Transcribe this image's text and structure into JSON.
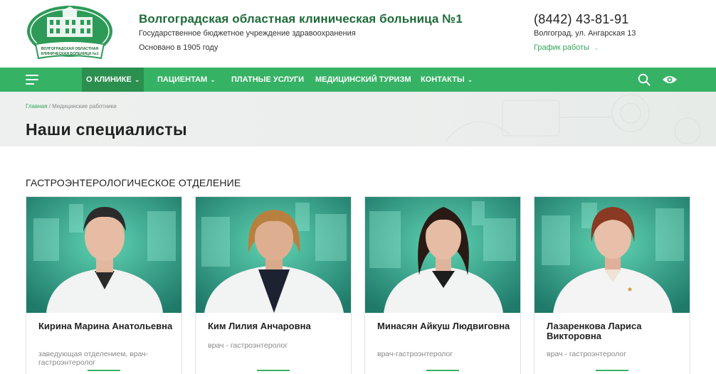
{
  "header": {
    "logo_text_line1": "ВОЛГОГРАДСКАЯ ОБЛАСТНАЯ",
    "logo_text_line2": "КЛИНИЧЕСКАЯ БОЛЬНИЦА №1",
    "title": "Волгоградская областная клиническая больница №1",
    "subtitle": "Государственное бюджетное учреждение здравоохранения",
    "founded": "Основано в 1905 году",
    "phone": "(8442) 43-81-91",
    "address": "Волгоград, ул. Ангарская 13",
    "schedule_label": "График работы",
    "accent_color": "#36b265",
    "title_color": "#1f6b3a"
  },
  "nav": {
    "menu_icon": "hamburger-icon",
    "items": [
      {
        "label": "О КЛИНИКЕ",
        "has_dropdown": true,
        "active": true
      },
      {
        "label": "ПАЦИЕНТАМ",
        "has_dropdown": true,
        "active": false
      },
      {
        "label": "ПЛАТНЫЕ УСЛУГИ",
        "has_dropdown": false,
        "active": false
      },
      {
        "label": "МЕДИЦИНСКИЙ ТУРИЗМ",
        "has_dropdown": false,
        "active": false
      },
      {
        "label": "КОНТАКТЫ",
        "has_dropdown": true,
        "active": false
      }
    ],
    "search_icon": "search-icon",
    "accessibility_icon": "eye-icon"
  },
  "banner": {
    "breadcrumb": [
      {
        "label": "Главная",
        "link": true
      },
      {
        "label": "Медицинские работники",
        "link": false
      }
    ],
    "breadcrumb_separator": "/",
    "page_title": "Наши специалисты"
  },
  "section": {
    "title": "ГАСТРОЭНТЕРОЛОГИЧЕСКОЕ ОТДЕЛЕНИЕ",
    "doctors": [
      {
        "name": "Кирина Марина Анатольевна",
        "role": "заведующая отделением, врач-гастроэнтеролог"
      },
      {
        "name": "Ким Лилия Анчаровна",
        "role": "врач - гастроэнтеролог"
      },
      {
        "name": "Минасян Айкуш Людвиговна",
        "role": "врач-гастроэнтеролог"
      },
      {
        "name": "Лазаренкова Лариса Викторовна",
        "role": "врач - гастроэнтеролог"
      }
    ]
  }
}
